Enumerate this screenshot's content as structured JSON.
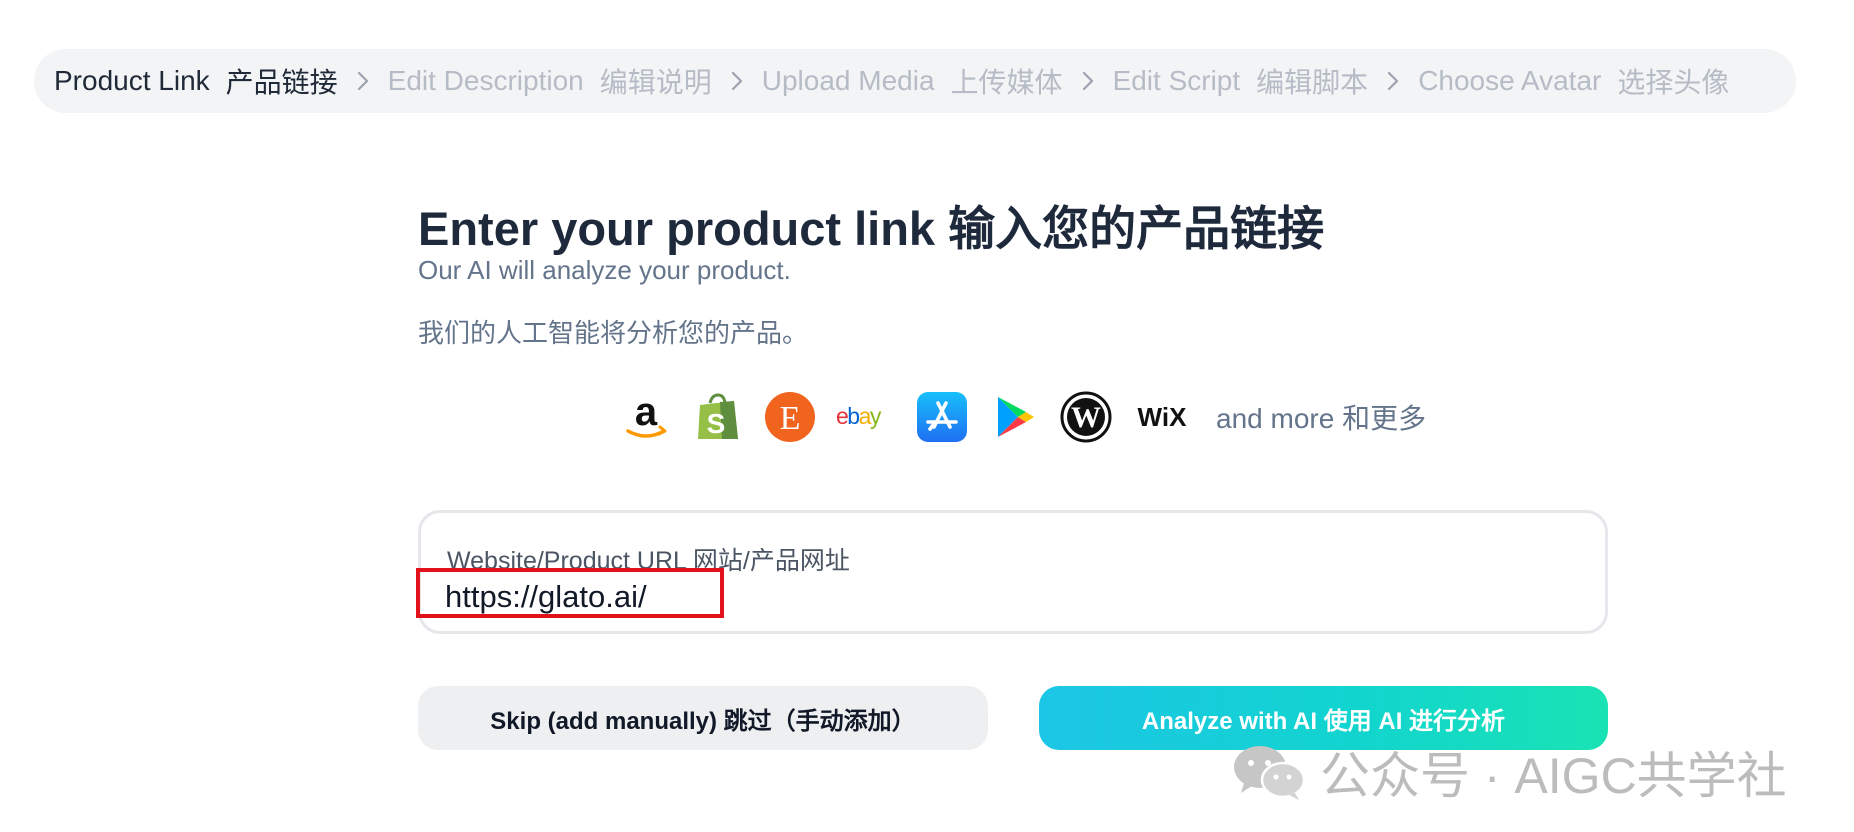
{
  "breadcrumb": {
    "steps": [
      {
        "en": "Product Link",
        "zh": "产品链接",
        "active": true
      },
      {
        "en": "Edit Description",
        "zh": "编辑说明",
        "active": false
      },
      {
        "en": "Upload Media",
        "zh": "上传媒体",
        "active": false
      },
      {
        "en": "Edit Script",
        "zh": "编辑脚本",
        "active": false
      },
      {
        "en": "Choose Avatar",
        "zh": "选择头像",
        "active": false
      }
    ]
  },
  "main": {
    "title": "Enter your product link 输入您的产品链接",
    "subtitle": "Our AI will analyze your product.",
    "subtitle_zh": "我们的人工智能将分析您的产品。"
  },
  "platforms": {
    "icons": [
      "amazon-icon",
      "shopify-icon",
      "etsy-icon",
      "ebay-icon",
      "app-store-icon",
      "google-play-icon",
      "wordpress-icon",
      "wix-icon"
    ],
    "more_label": "and more 和更多",
    "ebay_text": "ebay",
    "wix_text": "WiX",
    "etsy_text": "E"
  },
  "url_field": {
    "label": "Website/Product URL 网站/产品网址",
    "value": "https://glato.ai/"
  },
  "buttons": {
    "skip_label": "Skip (add manually)   跳过（手动添加）",
    "analyze_label": "Analyze with AI   使用 AI 进行分析"
  },
  "watermark": {
    "text": "公众号 · AIGC共学社"
  },
  "colors": {
    "accent_gradient_start": "#1cc6e6",
    "accent_gradient_end": "#19e3b3",
    "highlight_box": "#e3111a"
  }
}
